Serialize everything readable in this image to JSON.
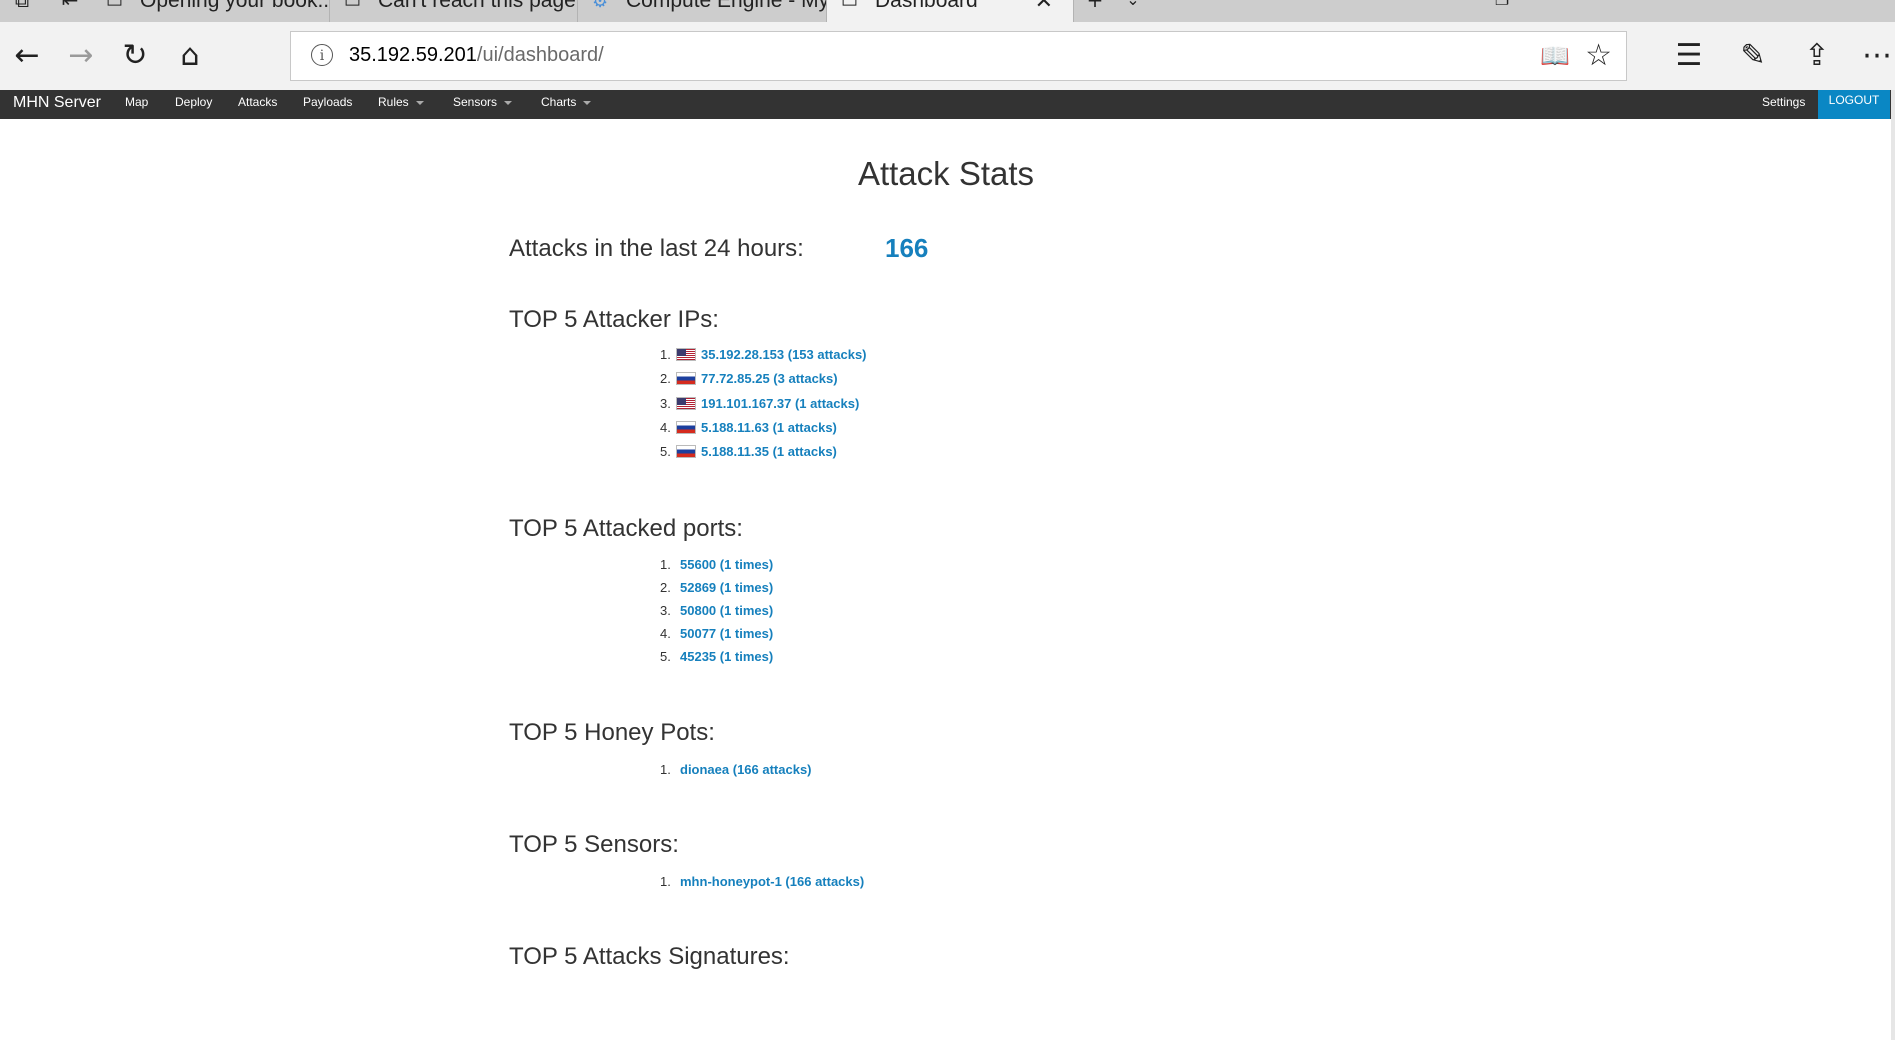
{
  "browser": {
    "tabs": [
      {
        "label": "Opening your book...",
        "icon": "book-icon"
      },
      {
        "label": "Can't reach this page",
        "icon": "page-icon"
      },
      {
        "label": "Compute Engine - My First",
        "icon": "gear-icon"
      },
      {
        "label": "Dashboard",
        "icon": "page-icon",
        "active": true
      }
    ],
    "url_host": "35.192.59.201",
    "url_path": "/ui/dashboard/"
  },
  "nav": {
    "brand": "MHN Server",
    "items": [
      {
        "label": "Map"
      },
      {
        "label": "Deploy"
      },
      {
        "label": "Attacks"
      },
      {
        "label": "Payloads"
      },
      {
        "label": "Rules",
        "dropdown": true
      },
      {
        "label": "Sensors",
        "dropdown": true
      },
      {
        "label": "Charts",
        "dropdown": true
      }
    ],
    "settings": "Settings",
    "logout": "LOGOUT"
  },
  "page": {
    "title": "Attack Stats",
    "attacks_24h_label": "Attacks in the last 24 hours:",
    "attacks_24h_value": "166",
    "top_ips": {
      "heading": "TOP 5 Attacker IPs:",
      "items": [
        {
          "num": "1.",
          "text": "35.192.28.153 (153 attacks)",
          "flag": "us"
        },
        {
          "num": "2.",
          "text": "77.72.85.25 (3 attacks)",
          "flag": "ru"
        },
        {
          "num": "3.",
          "text": "191.101.167.37 (1 attacks)",
          "flag": "us"
        },
        {
          "num": "4.",
          "text": "5.188.11.63 (1 attacks)",
          "flag": "ru"
        },
        {
          "num": "5.",
          "text": "5.188.11.35 (1 attacks)",
          "flag": "ru"
        }
      ]
    },
    "top_ports": {
      "heading": "TOP 5 Attacked ports:",
      "items": [
        {
          "num": "1.",
          "text": "55600 (1 times)"
        },
        {
          "num": "2.",
          "text": "52869 (1 times)"
        },
        {
          "num": "3.",
          "text": "50800 (1 times)"
        },
        {
          "num": "4.",
          "text": "50077 (1 times)"
        },
        {
          "num": "5.",
          "text": "45235 (1 times)"
        }
      ]
    },
    "top_honeypots": {
      "heading": "TOP 5 Honey Pots:",
      "items": [
        {
          "num": "1.",
          "text": "dionaea (166 attacks)"
        }
      ]
    },
    "top_sensors": {
      "heading": "TOP 5 Sensors:",
      "items": [
        {
          "num": "1.",
          "text": "mhn-honeypot-1 (166 attacks)"
        }
      ]
    },
    "top_signatures": {
      "heading": "TOP 5 Attacks Signatures:"
    }
  },
  "colors": {
    "link": "#1680bd",
    "navbar": "#333333",
    "logout": "#0a87c4"
  }
}
